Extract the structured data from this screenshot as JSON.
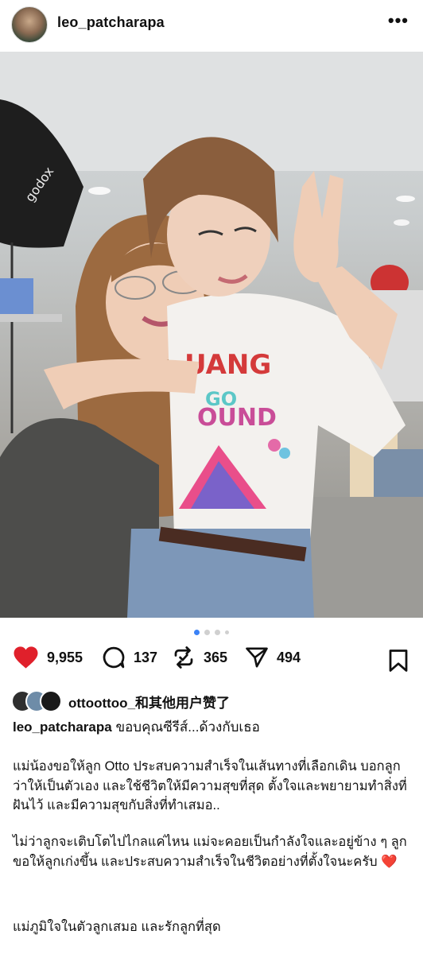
{
  "header": {
    "username": "leo_patcharapa",
    "more": "•••"
  },
  "carousel": {
    "total": 4,
    "active": 0
  },
  "actions": {
    "like_count": "9,955",
    "comment_count": "137",
    "repost_count": "365",
    "share_count": "494"
  },
  "likes_line": "ottoottoo_和其他用户赞了",
  "caption": {
    "username": "leo_patcharapa",
    "text": "ขอบคุณซีรีส์...ด้วงกับเธอ",
    "para1": "แม่น้องขอให้ลูก Otto ประสบความสำเร็จในเส้นทางที่เลือกเดิน บอกลูกว่าให้เป็นตัวเอง และใช้ชีวิตให้มีความสุขที่สุด ตั้งใจและพยายามทำสิ่งที่ฝันไว้ และมีความสุขกับสิ่งที่ทำเสมอ..",
    "para2": "ไม่ว่าลูกจะเติบโตไปไกลแค่ไหน แม่จะคอยเป็นกำลังใจและอยู่ข้าง ๆ ลูก ขอให้ลูกเก่งขึ้น  และประสบความสำเร็จในชีวิตอย่างที่ตั้งใจนะครับ",
    "para2_emoji": "❤️",
    "para3": "แม่ภูมิใจในตัวลูกเสมอ และรักลูกที่สุด"
  },
  "colors": {
    "like_red": "#e0202b",
    "accent_blue": "#3b82f6"
  }
}
